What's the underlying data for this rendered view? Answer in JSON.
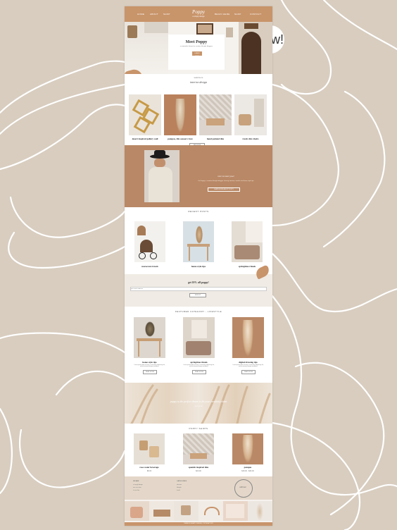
{
  "nav": {
    "items": [
      "HOME",
      "ABOUT",
      "SHOP",
      "BLOG",
      "CONTACT"
    ],
    "items_right": [
      "BEGIN HERE",
      "SHOP",
      "CONTACT"
    ],
    "logo": "Poppy",
    "logo_sub": "a simply design"
  },
  "hero": {
    "title": "Meet Poppy",
    "text": "a minimalist theme for creative lifestyle bloggers",
    "button": "LEARN MORE"
  },
  "badge": "new!",
  "interior": {
    "label": "welcome to",
    "title": "interior design",
    "items": [
      "desert inspired gallery wall",
      "pampas, this season's fave",
      "hand painted tiles",
      "rustic chic chairs"
    ],
    "button": "SEE MORE"
  },
  "about": {
    "label": "nice to meet you!",
    "text": "I'm Poppy, a creative lifestyle blogger sharing interiors, travels and home style tips",
    "button": "LEARN MORE ABOUT POPPY"
  },
  "recent": {
    "title": "RECENT POSTS",
    "items": [
      "moroccan travels",
      "home style tips",
      "springtime rituals"
    ]
  },
  "optin": {
    "title": "get 10% off poppy!",
    "placeholder": "your email address",
    "button": "SIGN UP"
  },
  "featured": {
    "title": "FEATURED CATEGORY - LIFESTYLE",
    "items": [
      "home style tips",
      "springtime rituals",
      "digital drawing tips"
    ],
    "excerpt": "Lorem ipsum dolor sit amet, consectetur adipiscing elit, sed do eiusmod tempor incididunt.",
    "button": "READ MORE"
  },
  "quote": {
    "text": "poppy is the perfect theme to let your creativity shine",
    "label": "SHOP NOW"
  },
  "shop": {
    "title": "POPPY SHOPS",
    "items": [
      {
        "name": "rose water beverage",
        "price": "$8.00"
      },
      {
        "name": "spanish inspired tiles",
        "price": "$20.00"
      },
      {
        "name": "pampas",
        "price": "$18.00 - $30.00"
      }
    ]
  },
  "footer": {
    "col1_title": "WE ARE",
    "col1_lines": [
      "a simply design",
      "one at a time",
      "in one line"
    ],
    "col2_title": "CATEGORIES",
    "col2_lines": [
      "interiors",
      "lifestyle",
      "travel"
    ],
    "signature": "with love",
    "copyright": "THEME BY A SIMPLY DESIGN | COPYRIGHT 2021"
  },
  "colors": {
    "accent": "#c8946a",
    "bg": "#d8cdbf",
    "beige": "#f0ebe4",
    "cream": "#ece4db"
  }
}
